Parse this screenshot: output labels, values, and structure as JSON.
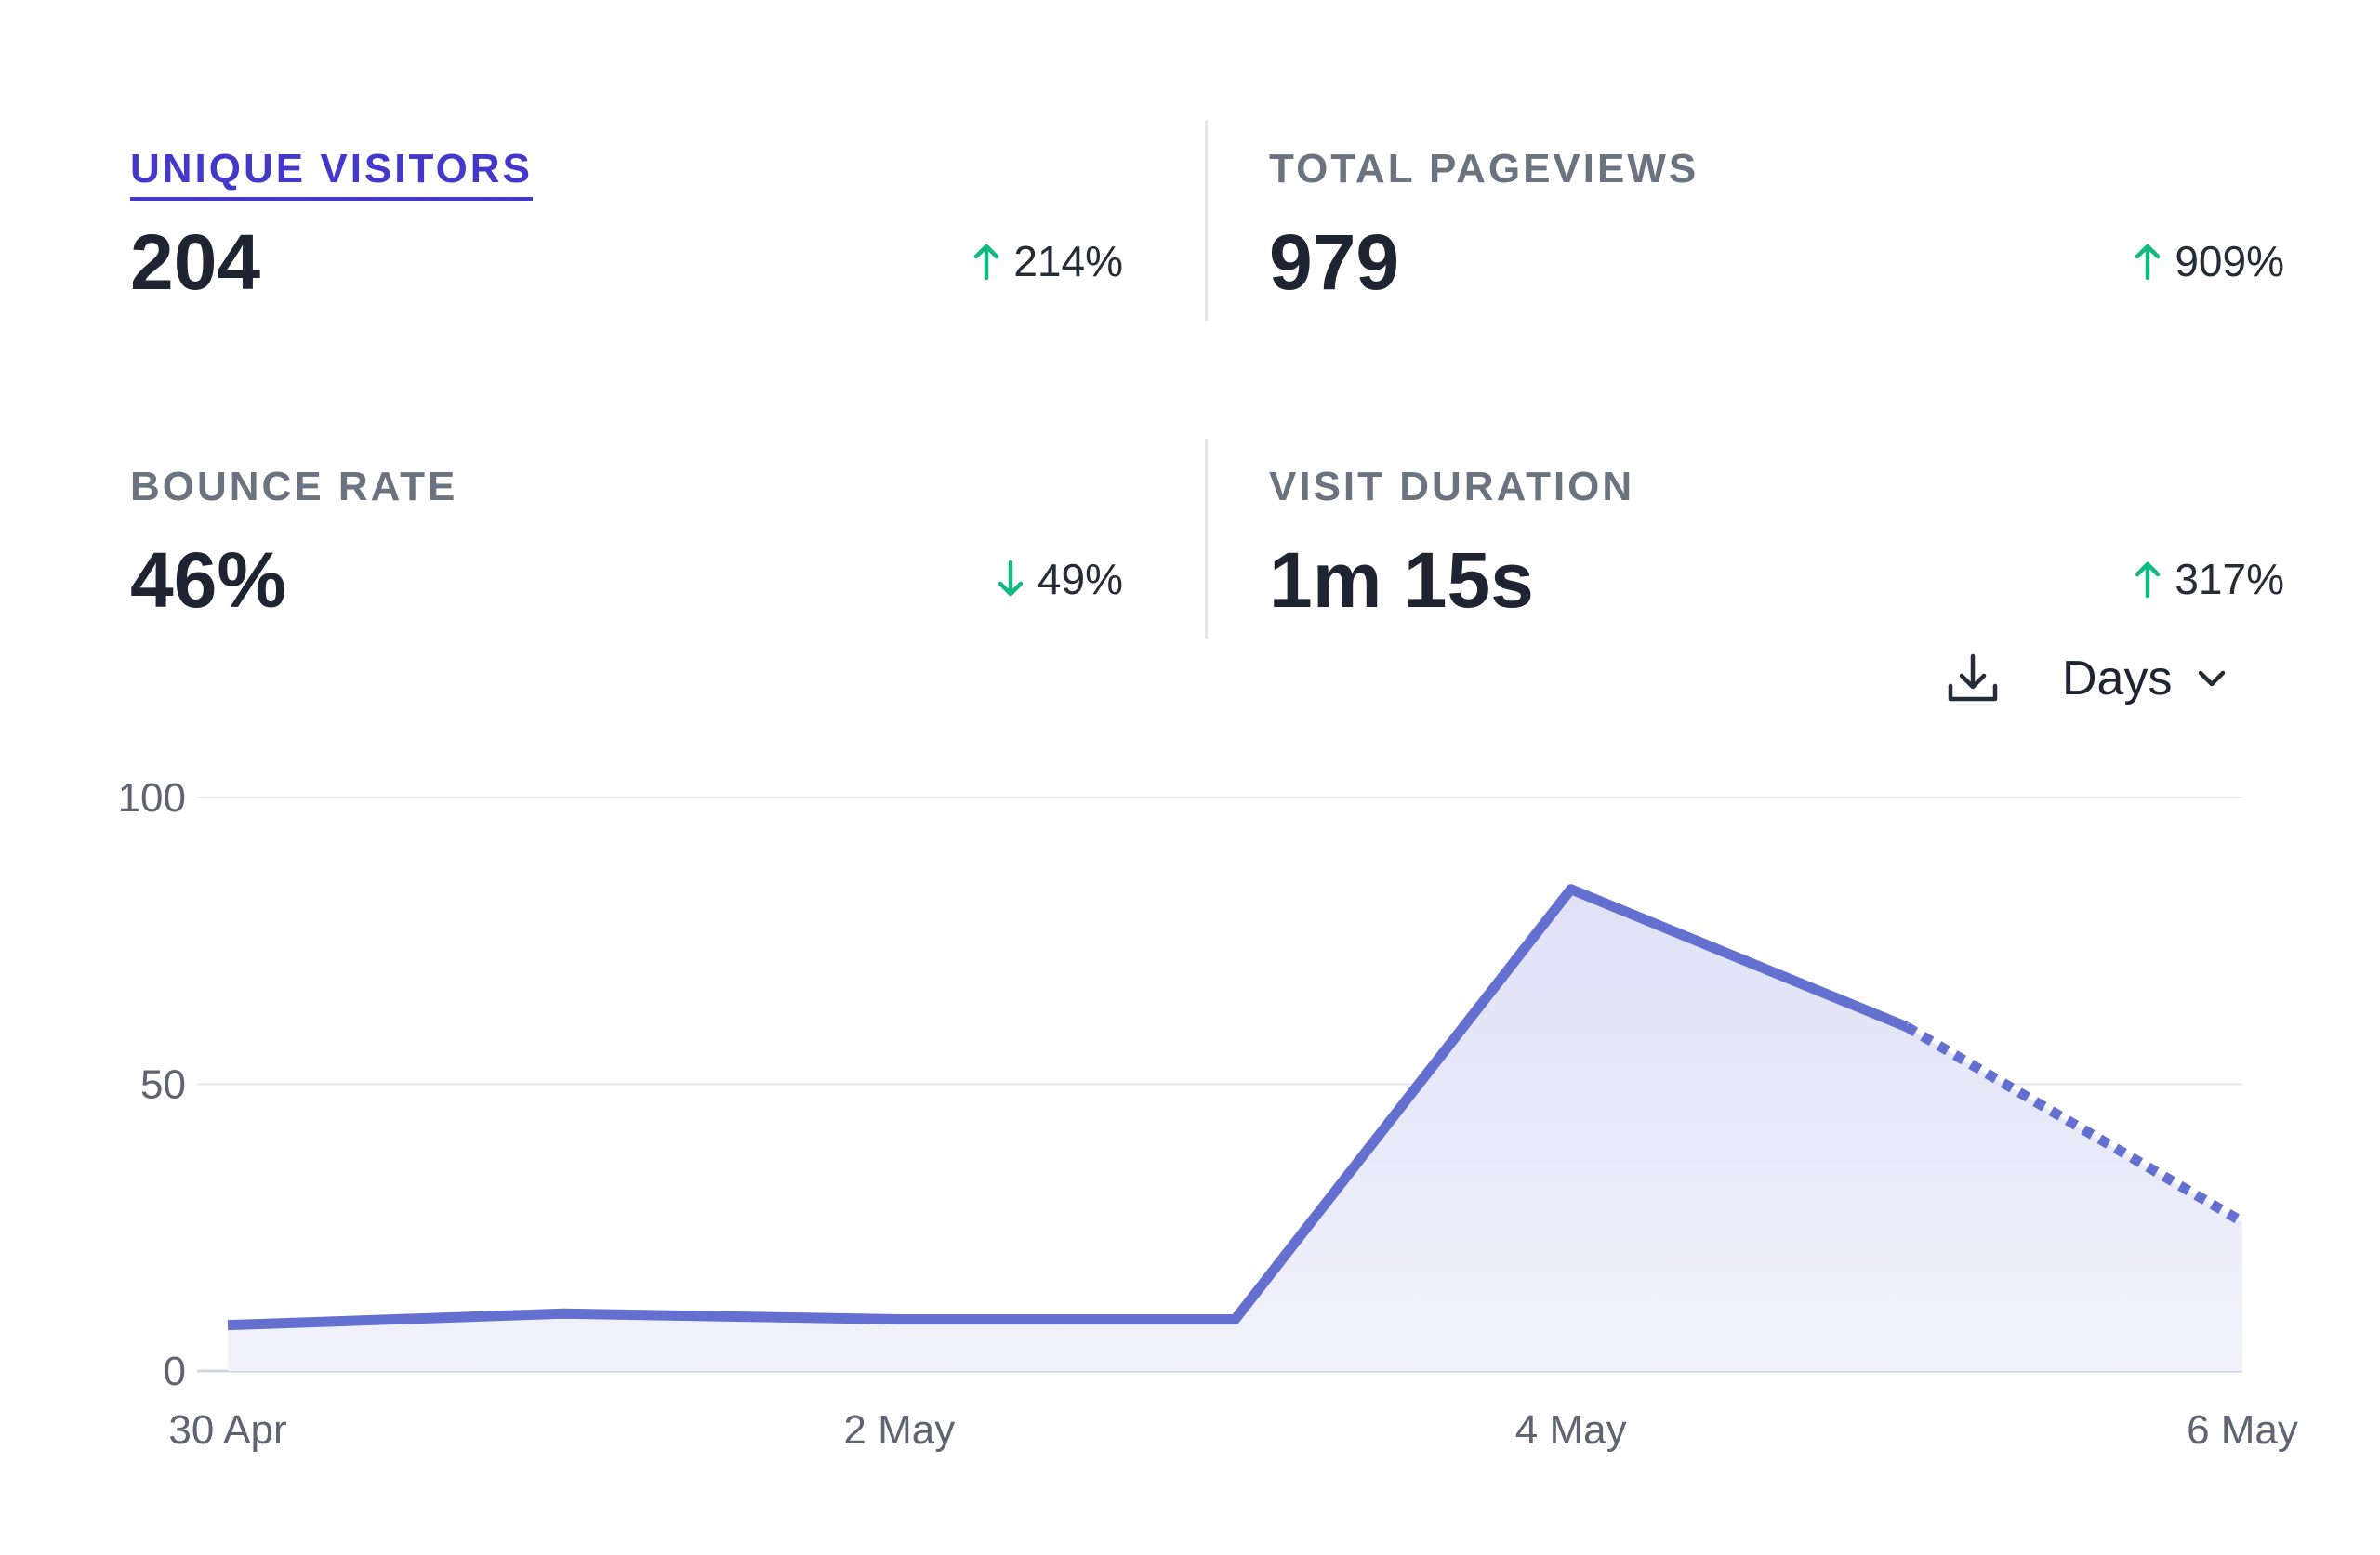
{
  "stats": {
    "unique_visitors": {
      "label": "UNIQUE VISITORS",
      "value": "204",
      "change": "214%",
      "direction": "up"
    },
    "total_pageviews": {
      "label": "TOTAL PAGEVIEWS",
      "value": "979",
      "change": "909%",
      "direction": "up"
    },
    "bounce_rate": {
      "label": "BOUNCE RATE",
      "value": "46%",
      "change": "49%",
      "direction": "down"
    },
    "visit_duration": {
      "label": "VISIT DURATION",
      "value": "1m 15s",
      "change": "317%",
      "direction": "up"
    }
  },
  "toolbar": {
    "download_icon": "download-icon",
    "interval_label": "Days",
    "interval_icon": "chevron-down-icon"
  },
  "colors": {
    "accent": "#4338ca",
    "line": "#6470d0",
    "area": "#e9eaf8",
    "positive": "#10b981",
    "label": "#6b7280",
    "value": "#1f2433"
  },
  "chart_data": {
    "type": "line",
    "x": [
      "30 Apr",
      "1 May",
      "2 May",
      "3 May",
      "4 May",
      "5 May",
      "6 May"
    ],
    "x_tick_labels": [
      "30 Apr",
      "2 May",
      "4 May",
      "6 May"
    ],
    "series": [
      {
        "values": [
          8,
          10,
          9,
          9,
          84,
          60,
          26
        ]
      }
    ],
    "incomplete_from_index": 5,
    "y_ticks": [
      "0",
      "50",
      "100"
    ],
    "ylim": [
      0,
      100
    ],
    "grid": true,
    "area_fill": true
  }
}
